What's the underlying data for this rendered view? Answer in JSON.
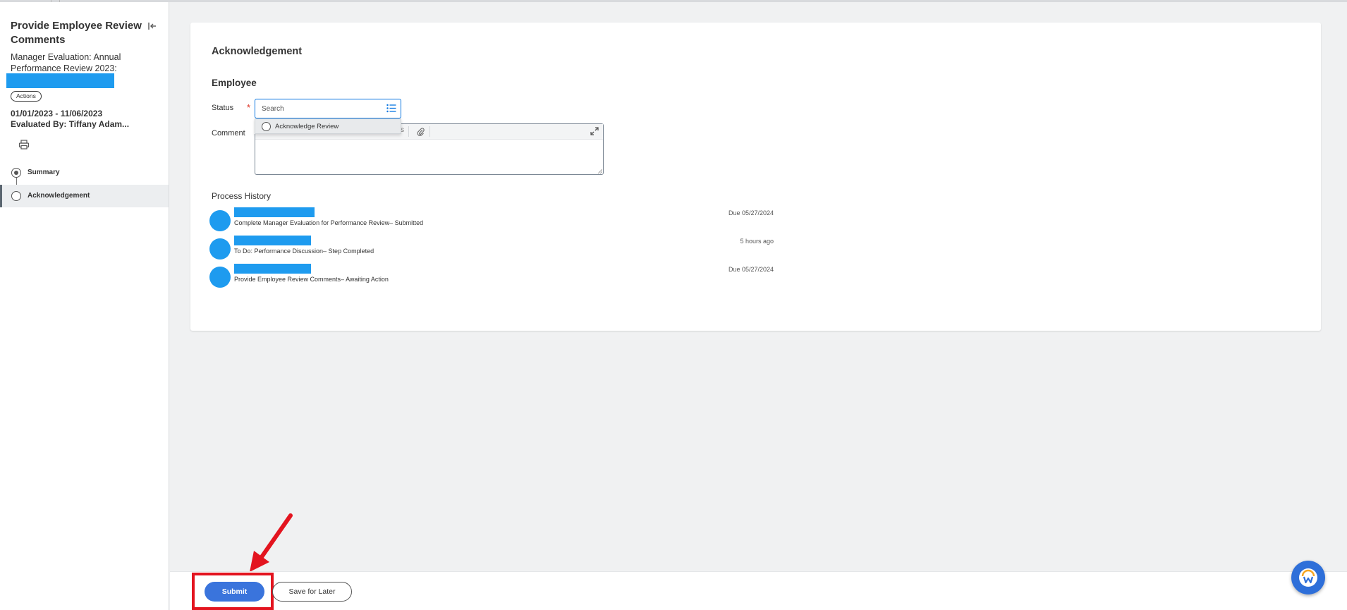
{
  "sidebar": {
    "title": "Provide Employee Review Comments",
    "subtitle": "Manager Evaluation: Annual Performance Review 2023:",
    "actions_label": "Actions",
    "dates": "01/01/2023 - 11/06/2023",
    "evaluated_by": "Evaluated By: Tiffany Adam...",
    "steps": [
      {
        "label": "Summary",
        "state": "complete"
      },
      {
        "label": "Acknowledgement",
        "state": "current"
      }
    ]
  },
  "main": {
    "title": "Acknowledgement",
    "section": "Employee",
    "status_label": "Status",
    "required_mark": "*",
    "status_placeholder": "Search",
    "status_options": [
      "Acknowledge Review"
    ],
    "comment_label": "Comment",
    "toolbar_fragment": "s",
    "process_history": {
      "title": "Process History",
      "items": [
        {
          "description": "Complete Manager Evaluation for Performance Review– Submitted",
          "when": "Due 05/27/2024"
        },
        {
          "description": "To Do: Performance Discussion– Step Completed",
          "when": "5 hours ago"
        },
        {
          "description": "Provide Employee Review Comments– Awaiting Action",
          "when": "Due 05/27/2024"
        }
      ]
    }
  },
  "footer": {
    "submit_label": "Submit",
    "save_later_label": "Save for Later"
  },
  "icons": {
    "collapse": "collapse-left-icon",
    "print": "print-icon",
    "list": "list-icon",
    "attach": "paperclip-icon",
    "expand": "expand-icon",
    "help": "workday-assistant-icon"
  },
  "colors": {
    "accent": "#0875e1",
    "submit": "#3a74dc",
    "redaction": "#1e9bef",
    "required": "#de2e21",
    "annotation": "#e3141f"
  }
}
